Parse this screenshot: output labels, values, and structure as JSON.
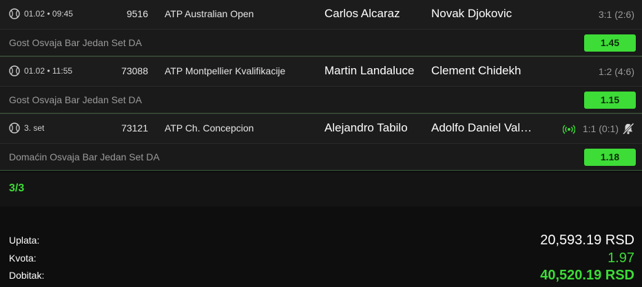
{
  "matches": [
    {
      "time": "01.02 • 09:45",
      "code": "9516",
      "league": "ATP Australian Open",
      "home": "Carlos Alcaraz",
      "away": "Novak Djokovic",
      "score": "3:1  (2:6)",
      "bet_label": "Gost Osvaja Bar Jedan Set DA",
      "odd": "1.45"
    },
    {
      "time": "01.02 • 11:55",
      "code": "73088",
      "league": "ATP Montpellier Kvalifikacije",
      "home": "Martin Landaluce",
      "away": "Clement Chidekh",
      "score": "1:2  (4:6)",
      "bet_label": "Gost Osvaja Bar Jedan Set DA",
      "odd": "1.15"
    },
    {
      "time": "3. set",
      "code": "73121",
      "league": "ATP Ch. Concepcion",
      "home": "Alejandro Tabilo",
      "away": "Adolfo Daniel Val…",
      "score": "1:1 (0:1)",
      "bet_label": "Domaćin Osvaja Bar Jedan Set DA",
      "odd": "1.18"
    }
  ],
  "ticket": {
    "count": "3/3"
  },
  "summary": {
    "stake_label": "Uplata:",
    "stake_value": "20,593.19 RSD",
    "odds_label": "Kvota:",
    "odds_value": "1.97",
    "win_label": "Dobitak:",
    "win_value": "40,520.19 RSD"
  },
  "colors": {
    "accent_green": "#3ddc37",
    "row_bg": "#1c1c1c",
    "page_bg": "#0e0e0e"
  },
  "icons": {
    "sport": "tennis-ball-icon",
    "live": "live-broadcast-icon",
    "bell": "bell-muted-icon"
  }
}
